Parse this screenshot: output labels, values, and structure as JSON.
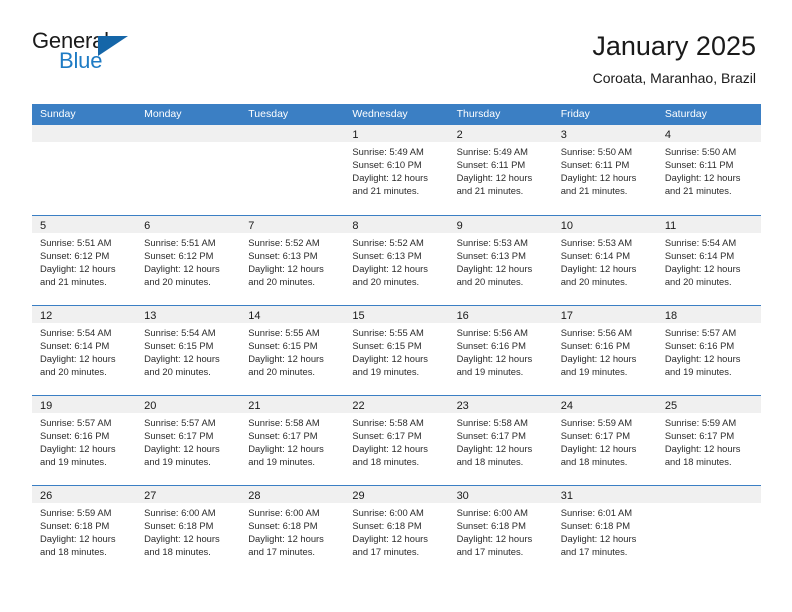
{
  "brand": {
    "word_one": "General",
    "word_two": "Blue",
    "triangle_icon": "brand-triangle-icon",
    "accent_color": "#1e7bc4",
    "triangle_color": "#1566a8"
  },
  "header": {
    "title": "January 2025",
    "subtitle": "Coroata, Maranhao, Brazil"
  },
  "calendar": {
    "header_bg": "#3b7fc4",
    "day_band_bg": "#f0f0f0",
    "weekday_headers": [
      "Sunday",
      "Monday",
      "Tuesday",
      "Wednesday",
      "Thursday",
      "Friday",
      "Saturday"
    ],
    "weeks": [
      [
        {
          "day": "",
          "lines": []
        },
        {
          "day": "",
          "lines": []
        },
        {
          "day": "",
          "lines": []
        },
        {
          "day": "1",
          "lines": [
            "Sunrise: 5:49 AM",
            "Sunset: 6:10 PM",
            "Daylight: 12 hours",
            "and 21 minutes."
          ]
        },
        {
          "day": "2",
          "lines": [
            "Sunrise: 5:49 AM",
            "Sunset: 6:11 PM",
            "Daylight: 12 hours",
            "and 21 minutes."
          ]
        },
        {
          "day": "3",
          "lines": [
            "Sunrise: 5:50 AM",
            "Sunset: 6:11 PM",
            "Daylight: 12 hours",
            "and 21 minutes."
          ]
        },
        {
          "day": "4",
          "lines": [
            "Sunrise: 5:50 AM",
            "Sunset: 6:11 PM",
            "Daylight: 12 hours",
            "and 21 minutes."
          ]
        }
      ],
      [
        {
          "day": "5",
          "lines": [
            "Sunrise: 5:51 AM",
            "Sunset: 6:12 PM",
            "Daylight: 12 hours",
            "and 21 minutes."
          ]
        },
        {
          "day": "6",
          "lines": [
            "Sunrise: 5:51 AM",
            "Sunset: 6:12 PM",
            "Daylight: 12 hours",
            "and 20 minutes."
          ]
        },
        {
          "day": "7",
          "lines": [
            "Sunrise: 5:52 AM",
            "Sunset: 6:13 PM",
            "Daylight: 12 hours",
            "and 20 minutes."
          ]
        },
        {
          "day": "8",
          "lines": [
            "Sunrise: 5:52 AM",
            "Sunset: 6:13 PM",
            "Daylight: 12 hours",
            "and 20 minutes."
          ]
        },
        {
          "day": "9",
          "lines": [
            "Sunrise: 5:53 AM",
            "Sunset: 6:13 PM",
            "Daylight: 12 hours",
            "and 20 minutes."
          ]
        },
        {
          "day": "10",
          "lines": [
            "Sunrise: 5:53 AM",
            "Sunset: 6:14 PM",
            "Daylight: 12 hours",
            "and 20 minutes."
          ]
        },
        {
          "day": "11",
          "lines": [
            "Sunrise: 5:54 AM",
            "Sunset: 6:14 PM",
            "Daylight: 12 hours",
            "and 20 minutes."
          ]
        }
      ],
      [
        {
          "day": "12",
          "lines": [
            "Sunrise: 5:54 AM",
            "Sunset: 6:14 PM",
            "Daylight: 12 hours",
            "and 20 minutes."
          ]
        },
        {
          "day": "13",
          "lines": [
            "Sunrise: 5:54 AM",
            "Sunset: 6:15 PM",
            "Daylight: 12 hours",
            "and 20 minutes."
          ]
        },
        {
          "day": "14",
          "lines": [
            "Sunrise: 5:55 AM",
            "Sunset: 6:15 PM",
            "Daylight: 12 hours",
            "and 20 minutes."
          ]
        },
        {
          "day": "15",
          "lines": [
            "Sunrise: 5:55 AM",
            "Sunset: 6:15 PM",
            "Daylight: 12 hours",
            "and 19 minutes."
          ]
        },
        {
          "day": "16",
          "lines": [
            "Sunrise: 5:56 AM",
            "Sunset: 6:16 PM",
            "Daylight: 12 hours",
            "and 19 minutes."
          ]
        },
        {
          "day": "17",
          "lines": [
            "Sunrise: 5:56 AM",
            "Sunset: 6:16 PM",
            "Daylight: 12 hours",
            "and 19 minutes."
          ]
        },
        {
          "day": "18",
          "lines": [
            "Sunrise: 5:57 AM",
            "Sunset: 6:16 PM",
            "Daylight: 12 hours",
            "and 19 minutes."
          ]
        }
      ],
      [
        {
          "day": "19",
          "lines": [
            "Sunrise: 5:57 AM",
            "Sunset: 6:16 PM",
            "Daylight: 12 hours",
            "and 19 minutes."
          ]
        },
        {
          "day": "20",
          "lines": [
            "Sunrise: 5:57 AM",
            "Sunset: 6:17 PM",
            "Daylight: 12 hours",
            "and 19 minutes."
          ]
        },
        {
          "day": "21",
          "lines": [
            "Sunrise: 5:58 AM",
            "Sunset: 6:17 PM",
            "Daylight: 12 hours",
            "and 19 minutes."
          ]
        },
        {
          "day": "22",
          "lines": [
            "Sunrise: 5:58 AM",
            "Sunset: 6:17 PM",
            "Daylight: 12 hours",
            "and 18 minutes."
          ]
        },
        {
          "day": "23",
          "lines": [
            "Sunrise: 5:58 AM",
            "Sunset: 6:17 PM",
            "Daylight: 12 hours",
            "and 18 minutes."
          ]
        },
        {
          "day": "24",
          "lines": [
            "Sunrise: 5:59 AM",
            "Sunset: 6:17 PM",
            "Daylight: 12 hours",
            "and 18 minutes."
          ]
        },
        {
          "day": "25",
          "lines": [
            "Sunrise: 5:59 AM",
            "Sunset: 6:17 PM",
            "Daylight: 12 hours",
            "and 18 minutes."
          ]
        }
      ],
      [
        {
          "day": "26",
          "lines": [
            "Sunrise: 5:59 AM",
            "Sunset: 6:18 PM",
            "Daylight: 12 hours",
            "and 18 minutes."
          ]
        },
        {
          "day": "27",
          "lines": [
            "Sunrise: 6:00 AM",
            "Sunset: 6:18 PM",
            "Daylight: 12 hours",
            "and 18 minutes."
          ]
        },
        {
          "day": "28",
          "lines": [
            "Sunrise: 6:00 AM",
            "Sunset: 6:18 PM",
            "Daylight: 12 hours",
            "and 17 minutes."
          ]
        },
        {
          "day": "29",
          "lines": [
            "Sunrise: 6:00 AM",
            "Sunset: 6:18 PM",
            "Daylight: 12 hours",
            "and 17 minutes."
          ]
        },
        {
          "day": "30",
          "lines": [
            "Sunrise: 6:00 AM",
            "Sunset: 6:18 PM",
            "Daylight: 12 hours",
            "and 17 minutes."
          ]
        },
        {
          "day": "31",
          "lines": [
            "Sunrise: 6:01 AM",
            "Sunset: 6:18 PM",
            "Daylight: 12 hours",
            "and 17 minutes."
          ]
        },
        {
          "day": "",
          "lines": []
        }
      ]
    ]
  }
}
